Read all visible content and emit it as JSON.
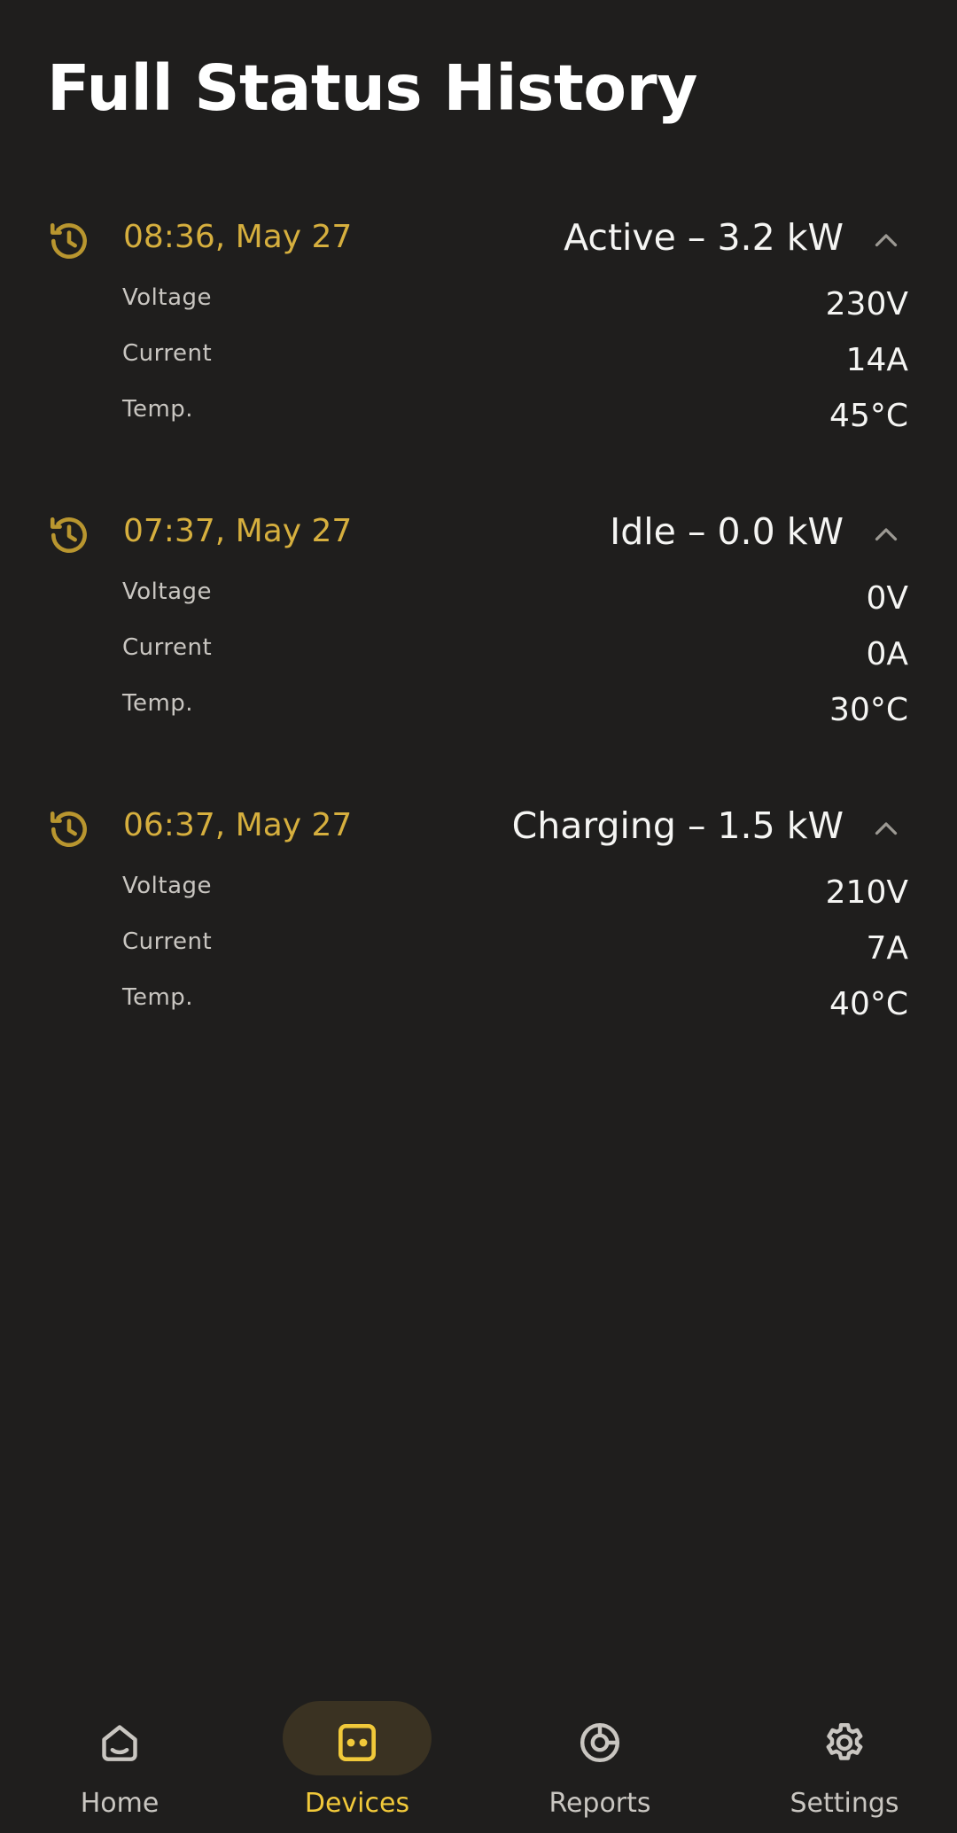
{
  "page": {
    "title": "Full Status History"
  },
  "colors": {
    "background": "#1f1e1d",
    "accent": "#d6af3e",
    "active_nav": "#f1c93a",
    "text_primary": "#f5f5f3",
    "text_secondary": "#c9c6c1"
  },
  "history": [
    {
      "time": "08:36, May 27",
      "status": "Active – 3.2 kW",
      "icon": "history-icon",
      "expanded": true,
      "metrics": [
        {
          "label": "Voltage",
          "value": "230V"
        },
        {
          "label": "Current",
          "value": "14A"
        },
        {
          "label": "Temp.",
          "value": "45°C"
        }
      ]
    },
    {
      "time": "07:37, May 27",
      "status": "Idle – 0.0 kW",
      "icon": "history-icon",
      "expanded": true,
      "metrics": [
        {
          "label": "Voltage",
          "value": "0V"
        },
        {
          "label": "Current",
          "value": "0A"
        },
        {
          "label": "Temp.",
          "value": "30°C"
        }
      ]
    },
    {
      "time": "06:37, May 27",
      "status": "Charging – 1.5 kW",
      "icon": "history-icon",
      "expanded": true,
      "metrics": [
        {
          "label": "Voltage",
          "value": "210V"
        },
        {
          "label": "Current",
          "value": "7A"
        },
        {
          "label": "Temp.",
          "value": "40°C"
        }
      ]
    }
  ],
  "nav": {
    "active": "Devices",
    "items": [
      {
        "label": "Home",
        "icon": "home-icon"
      },
      {
        "label": "Devices",
        "icon": "device-icon"
      },
      {
        "label": "Reports",
        "icon": "reports-icon"
      },
      {
        "label": "Settings",
        "icon": "gear-icon"
      }
    ]
  }
}
